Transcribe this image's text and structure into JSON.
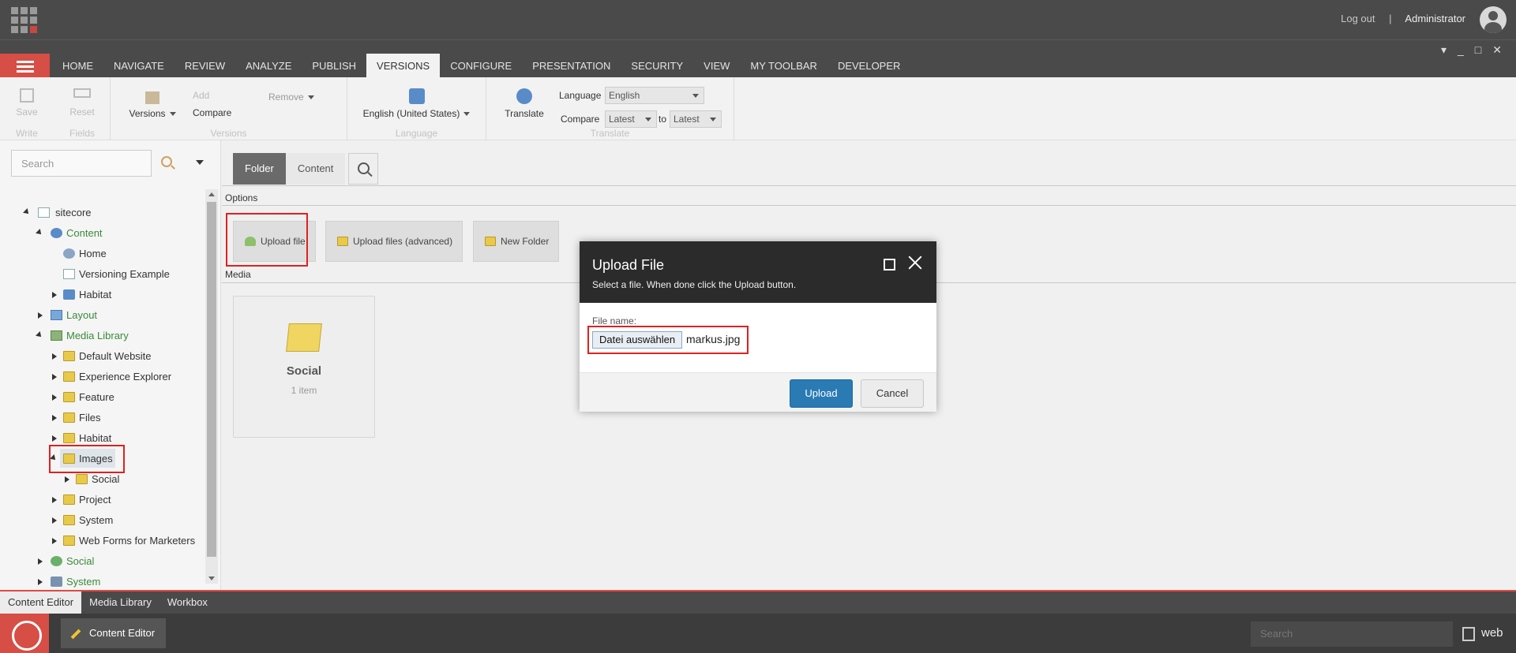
{
  "top": {
    "logout": "Log out",
    "separator": "|",
    "user": "Administrator"
  },
  "tabs": [
    "HOME",
    "NAVIGATE",
    "REVIEW",
    "ANALYZE",
    "PUBLISH",
    "VERSIONS",
    "CONFIGURE",
    "PRESENTATION",
    "SECURITY",
    "VIEW",
    "MY TOOLBAR",
    "DEVELOPER"
  ],
  "active_tab": "VERSIONS",
  "ribbon": {
    "write": {
      "save": "Save",
      "label": "Write"
    },
    "fields": {
      "reset": "Reset",
      "label": "Fields"
    },
    "versions": {
      "versions": "Versions",
      "add": "Add",
      "remove": "Remove",
      "compare": "Compare",
      "label": "Versions"
    },
    "language": {
      "button": "English (United States)",
      "label": "Language"
    },
    "translate": {
      "button": "Translate",
      "language_label": "Language",
      "language_value": "English",
      "compare_label": "Compare",
      "compare_from": "Latest",
      "to": "to",
      "compare_to": "Latest",
      "label": "Translate"
    }
  },
  "search": {
    "placeholder": "Search"
  },
  "tree": [
    {
      "label": "sitecore",
      "icon": "page-icon"
    },
    {
      "label": "Content",
      "icon": "globe-icon"
    },
    {
      "label": "Home",
      "icon": "globe-icon"
    },
    {
      "label": "Versioning Example",
      "icon": "page-icon"
    },
    {
      "label": "Habitat",
      "icon": "globe-icon"
    },
    {
      "label": "Layout",
      "icon": "layout-icon"
    },
    {
      "label": "Media Library",
      "icon": "media-icon"
    },
    {
      "label": "Default Website",
      "icon": "folder-icon"
    },
    {
      "label": "Experience Explorer",
      "icon": "folder-icon"
    },
    {
      "label": "Feature",
      "icon": "folder-icon"
    },
    {
      "label": "Files",
      "icon": "folder-icon"
    },
    {
      "label": "Habitat",
      "icon": "folder-icon"
    },
    {
      "label": "Images",
      "icon": "folder-icon"
    },
    {
      "label": "Social",
      "icon": "folder-icon"
    },
    {
      "label": "Project",
      "icon": "folder-icon"
    },
    {
      "label": "System",
      "icon": "folder-icon"
    },
    {
      "label": "Web Forms for Marketers",
      "icon": "folder-icon"
    },
    {
      "label": "Social",
      "icon": "globe-icon"
    },
    {
      "label": "System",
      "icon": "globe-icon"
    }
  ],
  "content": {
    "tabs": [
      "Folder",
      "Content"
    ],
    "options_label": "Options",
    "media_label": "Media",
    "buttons": [
      "Upload file",
      "Upload files (advanced)",
      "New Folder"
    ],
    "tile": {
      "name": "Social",
      "count": "1 item"
    }
  },
  "dialog": {
    "title": "Upload File",
    "subtitle": "Select a file. When done click the Upload button.",
    "file_label": "File name:",
    "choose": "Datei auswählen",
    "file_name": "markus.jpg",
    "upload": "Upload",
    "cancel": "Cancel"
  },
  "bottom_tabs": [
    "Content Editor",
    "Media Library",
    "Workbox"
  ],
  "taskbar": {
    "app": "Content Editor",
    "search_placeholder": "Search",
    "db": "web"
  },
  "colors": {
    "accent_red": "#d64e45",
    "dark_bar": "#4a4a4a",
    "primary_button": "#2a7ab4",
    "highlight_box": "#e02020"
  }
}
